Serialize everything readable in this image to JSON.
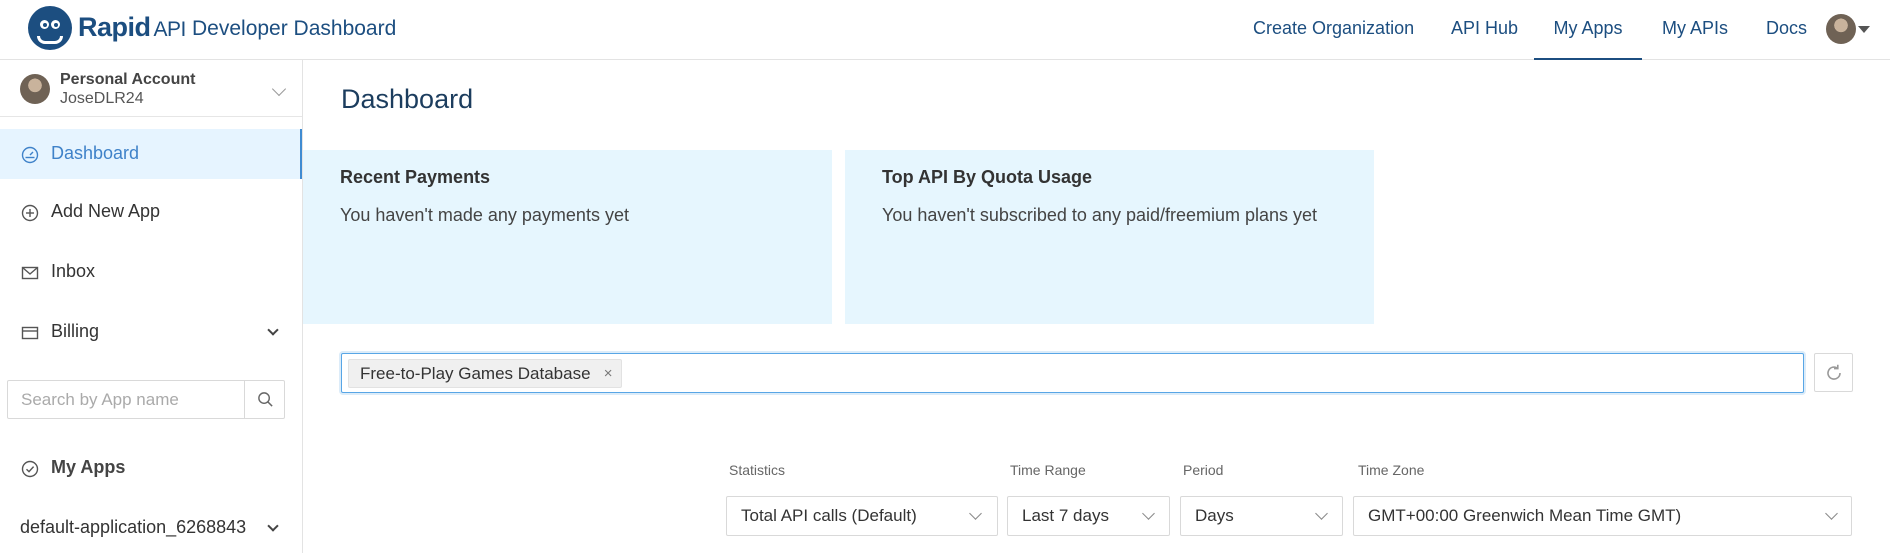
{
  "header": {
    "brand": "Rapid",
    "brand_suffix": "API",
    "title": "Developer Dashboard",
    "nav": [
      {
        "label": "Create Organization"
      },
      {
        "label": "API Hub"
      },
      {
        "label": "My Apps",
        "active": true
      },
      {
        "label": "My APIs"
      },
      {
        "label": "Docs"
      }
    ]
  },
  "sidebar": {
    "account": {
      "type": "Personal Account",
      "username": "JoseDLR24"
    },
    "items": [
      {
        "label": "Dashboard",
        "icon": "dashboard-gauge-icon",
        "active": true
      },
      {
        "label": "Add New App",
        "icon": "plus-circle-icon"
      },
      {
        "label": "Inbox",
        "icon": "mail-icon"
      },
      {
        "label": "Billing",
        "icon": "credit-card-icon",
        "expandable": true
      }
    ],
    "search": {
      "placeholder": "Search by App name",
      "value": ""
    },
    "section_title": "My Apps",
    "app_item": "default-application_6268843"
  },
  "main": {
    "title": "Dashboard",
    "cards": [
      {
        "title": "Recent Payments",
        "body": "You haven't made any payments yet"
      },
      {
        "title": "Top API By Quota Usage",
        "body": "You haven't subscribed to any paid/freemium plans yet"
      }
    ],
    "selected_api_tag": "Free-to-Play Games Database",
    "filters": {
      "statistics": {
        "label": "Statistics",
        "value": "Total API calls (Default)"
      },
      "time_range": {
        "label": "Time Range",
        "value": "Last 7 days"
      },
      "period": {
        "label": "Period",
        "value": "Days"
      },
      "time_zone": {
        "label": "Time Zone",
        "value": "GMT+00:00 Greenwich Mean Time GMT)"
      }
    }
  },
  "colors": {
    "brand": "#1c4e80",
    "active_item_bg": "#e6f4ff",
    "active_item_text": "#3f82c9",
    "card_bg": "#e6f6fe",
    "focus_border": "#58a6e6"
  }
}
